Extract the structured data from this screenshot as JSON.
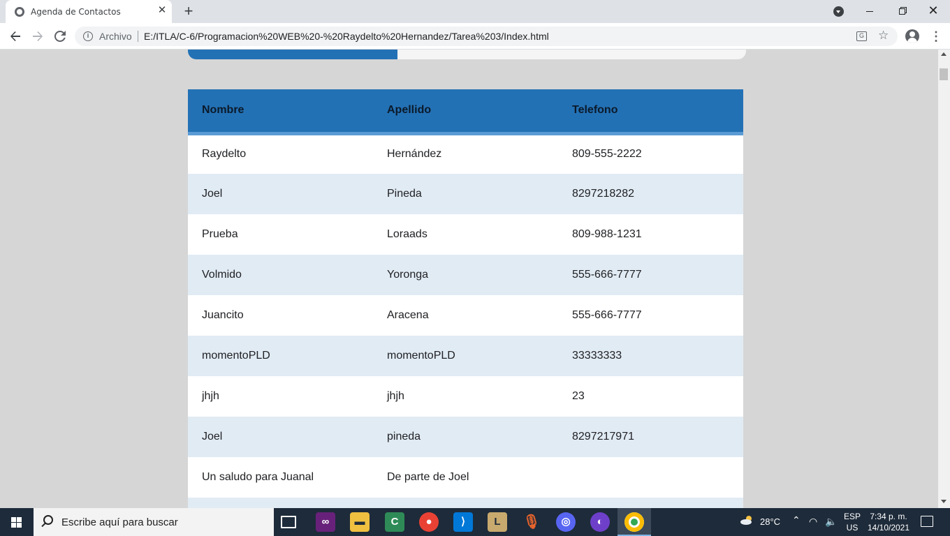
{
  "browser": {
    "tab_title": "Agenda de Contactos",
    "new_tab": "+",
    "scheme_label": "Archivo",
    "url": "E:/ITLA/C-6/Programacion%20WEB%20-%20Raydelto%20Hernandez/Tarea%203/Index.html"
  },
  "page": {
    "progress_fraction": 0.375,
    "table": {
      "headers": [
        "Nombre",
        "Apellido",
        "Telefono"
      ],
      "rows": [
        [
          "Raydelto",
          "Hernández",
          "809-555-2222"
        ],
        [
          "Joel",
          "Pineda",
          "8297218282"
        ],
        [
          "Prueba",
          "Loraads",
          "809-988-1231"
        ],
        [
          "Volmido",
          "Yoronga",
          "555-666-7777"
        ],
        [
          "Juancito",
          "Aracena",
          "555-666-7777"
        ],
        [
          "momentoPLD",
          "momentoPLD",
          "33333333"
        ],
        [
          "jhjh",
          "jhjh",
          "23"
        ],
        [
          "Joel",
          "pineda",
          "8297217971"
        ],
        [
          "Un saludo para Juanal",
          "De parte de Joel",
          ""
        ]
      ]
    }
  },
  "taskbar": {
    "search_placeholder": "Escribe aquí para buscar",
    "temperature": "28°C",
    "lang_line1": "ESP",
    "lang_line2": "US",
    "time": "7:34 p. m.",
    "date": "14/10/2021",
    "apps": [
      "task-view",
      "visual-studio",
      "file-explorer",
      "cs-app",
      "chrome-alt",
      "vscode",
      "league-of-legends",
      "microphone",
      "discord",
      "github-desktop",
      "chrome"
    ]
  },
  "colors": {
    "accent_blue": "#2371b5",
    "row_alt": "#e1ebf4",
    "page_bg": "#d6d6d6"
  }
}
